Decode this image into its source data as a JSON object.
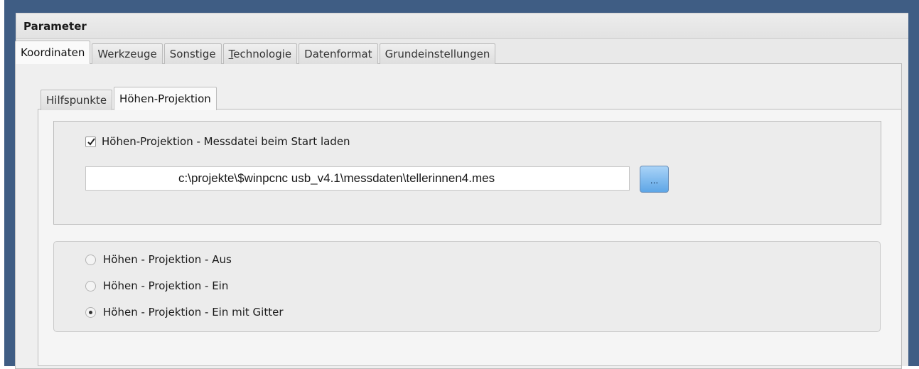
{
  "window": {
    "title": "Parameter"
  },
  "main_tabs": [
    {
      "label": "Koordinaten",
      "active": true
    },
    {
      "label": "Werkzeuge",
      "active": false
    },
    {
      "label": "Sonstige",
      "active": false
    },
    {
      "label_prefix": "",
      "label_underline": "T",
      "label_rest": "echnologie",
      "active": false
    },
    {
      "label": "Datenformat",
      "active": false
    },
    {
      "label": "Grundeinstellungen",
      "active": false
    }
  ],
  "sub_tabs": [
    {
      "label": "Hilfspunkte",
      "active": false
    },
    {
      "label": "Höhen-Projektion",
      "active": true
    }
  ],
  "measure_file": {
    "checkbox_label": "Höhen-Projektion - Messdatei beim Start laden",
    "checked": true,
    "path_value": "c:\\projekte\\$winpcnc usb_v4.1\\messdaten\\tellerinnen4.mes",
    "browse_label": "..."
  },
  "projection_mode": {
    "options": [
      {
        "label": "Höhen - Projektion - Aus",
        "selected": false
      },
      {
        "label": "Höhen - Projektion - Ein",
        "selected": false
      },
      {
        "label": "Höhen - Projektion - Ein mit Gitter",
        "selected": true
      }
    ]
  },
  "colors": {
    "frame": "#3f5d84",
    "window_bg": "#e9e9e9",
    "browse_button": "#5ea6e6"
  }
}
